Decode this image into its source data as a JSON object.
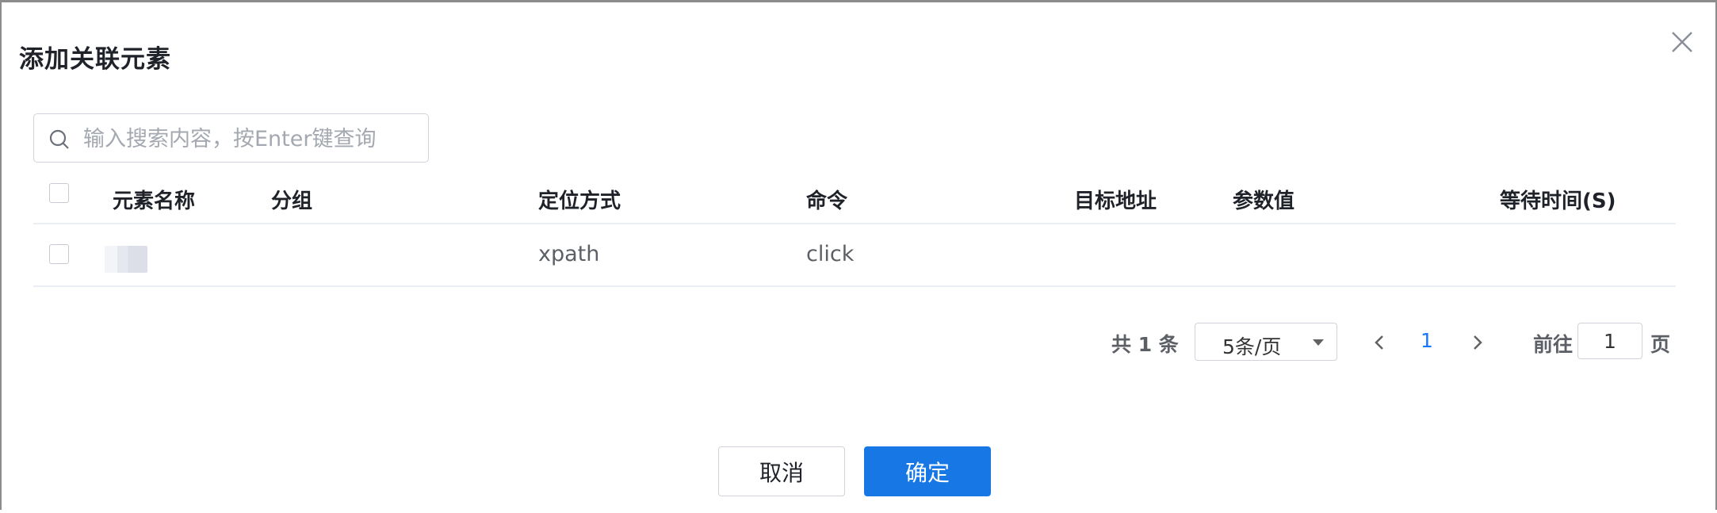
{
  "dialog": {
    "title": "添加关联元素"
  },
  "search": {
    "placeholder": "输入搜索内容，按Enter键查询",
    "value": ""
  },
  "table": {
    "columns": [
      "元素名称",
      "分组",
      "定位方式",
      "命令",
      "目标地址",
      "参数值",
      "等待时间(S)"
    ],
    "rows": [
      {
        "name": "",
        "group": "",
        "locator": "xpath",
        "command": "click",
        "target": "",
        "param": "",
        "wait": ""
      }
    ]
  },
  "pagination": {
    "total": "共 1 条",
    "page_size": "5条/页",
    "current_page": "1",
    "goto_label": "前往",
    "goto_value": "1",
    "page_suffix": "页"
  },
  "footer": {
    "cancel_label": "取消",
    "confirm_label": "确定"
  },
  "colors": {
    "primary": "#1677e5",
    "link": "#1677ff"
  }
}
